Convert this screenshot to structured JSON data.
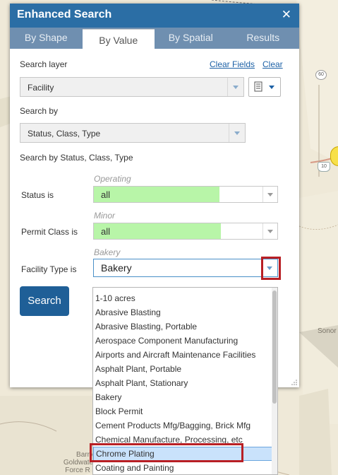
{
  "map": {
    "labels": [
      "Barry",
      "Goldwate",
      "Force R",
      "Sonor"
    ],
    "shields": [
      "60",
      "10"
    ]
  },
  "panel": {
    "title": "Enhanced Search",
    "close_symbol": "✕",
    "tabs": [
      {
        "label": "By Shape"
      },
      {
        "label": "By Value"
      },
      {
        "label": "By Spatial"
      },
      {
        "label": "Results"
      }
    ],
    "active_tab": "By Value",
    "search_layer_label": "Search layer",
    "clear_fields_link": "Clear Fields",
    "clear_link": "Clear",
    "search_layer_value": "Facility",
    "search_by_label": "Search by",
    "search_by_value": "Status, Class, Type",
    "search_by_description": "Search by Status, Class, Type",
    "status": {
      "label": "Status is",
      "hint": "Operating",
      "value": "all"
    },
    "permit_class": {
      "label": "Permit Class is",
      "hint": "Minor",
      "value": "all"
    },
    "facility_type": {
      "label": "Facility Type is",
      "hint": "Bakery",
      "value": "Bakery"
    },
    "search_button": "Search"
  },
  "dropdown": {
    "options": [
      "1-10 acres",
      "Abrasive Blasting",
      "Abrasive Blasting, Portable",
      "Aerospace Component Manufacturing",
      "Airports and Aircraft Maintenance Facilities",
      "Asphalt Plant, Portable",
      "Asphalt Plant, Stationary",
      "Bakery",
      "Block Permit",
      "Cement Products Mfg/Bagging, Brick Mfg",
      "Chemical Manufacture, Processing, etc",
      "Chrome Plating",
      "Coating and Painting"
    ],
    "highlighted": "Chrome Plating"
  },
  "colors": {
    "title_bar": "#2b6ea5",
    "tab_strip": "#6f8fb0",
    "search_button": "#1f5f97",
    "value_fill": "#b8f5a8",
    "highlight": "#c9e2fb",
    "annotation_red": "#b81f24"
  },
  "icons": {
    "close": "close-icon",
    "layer_list": "list-icon",
    "dropdown": "chevron-down-icon",
    "resize": "resize-grip-icon"
  }
}
